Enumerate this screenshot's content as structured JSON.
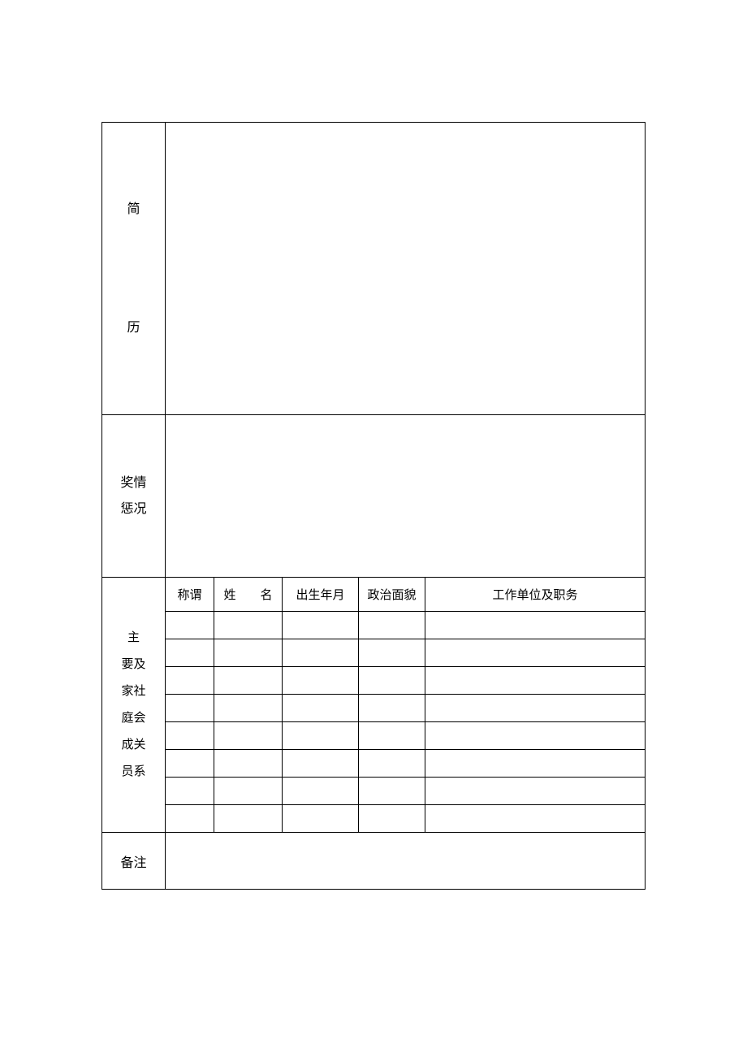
{
  "sections": {
    "resume": {
      "label_char1": "简",
      "label_char2": "历",
      "content": ""
    },
    "reward": {
      "label_line1": "奖情",
      "label_line2": "惩况",
      "content": ""
    },
    "family": {
      "label_line1": "主",
      "label_line2": "要及",
      "label_line3": "家社",
      "label_line4": "庭会",
      "label_line5": "成关",
      "label_line6": "员系",
      "headers": {
        "relation": "称谓",
        "name": "姓　　名",
        "birth": "出生年月",
        "politics": "政治面貌",
        "work": "工作单位及职务"
      },
      "rows": [
        {
          "relation": "",
          "name": "",
          "birth": "",
          "politics": "",
          "work": ""
        },
        {
          "relation": "",
          "name": "",
          "birth": "",
          "politics": "",
          "work": ""
        },
        {
          "relation": "",
          "name": "",
          "birth": "",
          "politics": "",
          "work": ""
        },
        {
          "relation": "",
          "name": "",
          "birth": "",
          "politics": "",
          "work": ""
        },
        {
          "relation": "",
          "name": "",
          "birth": "",
          "politics": "",
          "work": ""
        },
        {
          "relation": "",
          "name": "",
          "birth": "",
          "politics": "",
          "work": ""
        },
        {
          "relation": "",
          "name": "",
          "birth": "",
          "politics": "",
          "work": ""
        },
        {
          "relation": "",
          "name": "",
          "birth": "",
          "politics": "",
          "work": ""
        }
      ]
    },
    "remark": {
      "label": "备注",
      "content": ""
    }
  }
}
